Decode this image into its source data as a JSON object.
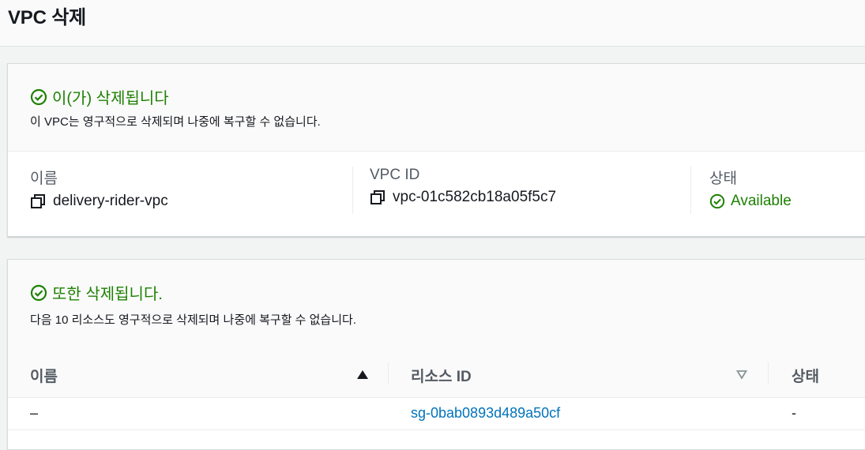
{
  "page": {
    "title": "VPC 삭제"
  },
  "vpc_notice": {
    "title": "이(가) 삭제됩니다",
    "description": "이 VPC는 영구적으로 삭제되며 나중에 복구할 수 없습니다."
  },
  "vpc_details": {
    "name_label": "이름",
    "name_value": "delivery-rider-vpc",
    "id_label": "VPC ID",
    "id_value": "vpc-01c582cb18a05f5c7",
    "state_label": "상태",
    "state_value": "Available"
  },
  "resources_notice": {
    "title": "또한 삭제됩니다.",
    "description": "다음 10 리소스도 영구적으로 삭제되며 나중에 복구할 수 없습니다."
  },
  "resources_table": {
    "columns": [
      "이름",
      "리소스 ID",
      "상태"
    ],
    "rows": [
      {
        "name": "–",
        "resource_id": "sg-0bab0893d489a50cf",
        "state": "-"
      }
    ]
  },
  "colors": {
    "success": "#1d8102",
    "link": "#0073bb",
    "text": "#16191f",
    "muted": "#545b64"
  },
  "icons": [
    "check-circle-icon",
    "copy-icon",
    "sort-ascending-icon",
    "sort-descending-icon"
  ]
}
